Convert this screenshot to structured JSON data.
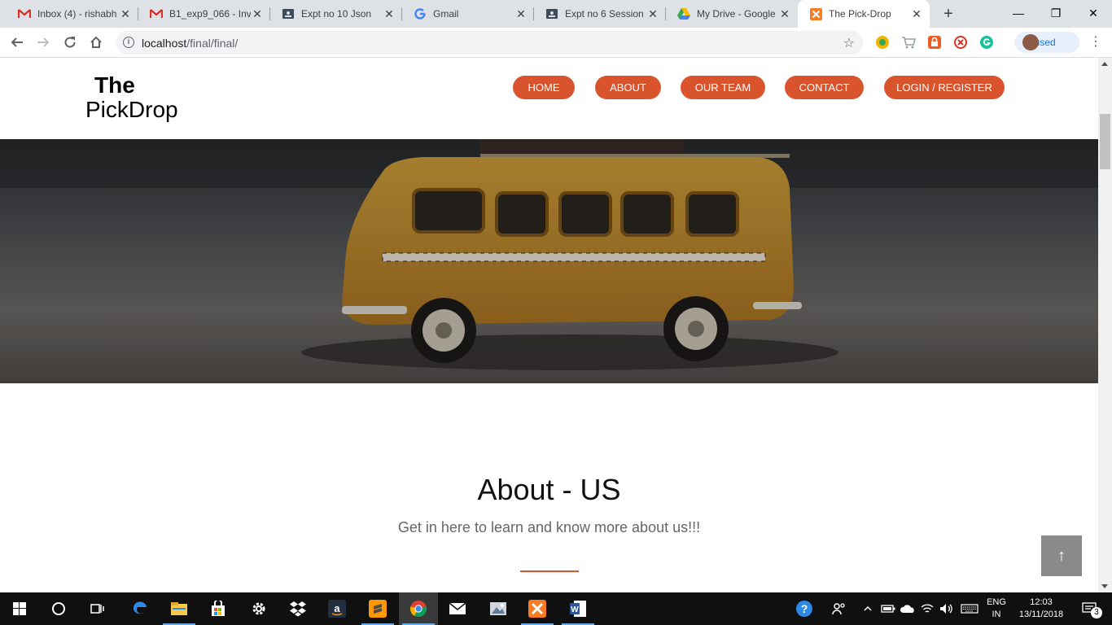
{
  "browser": {
    "tabs": [
      {
        "title": "Inbox (4) - rishabh",
        "icon": "gmail-icon",
        "active": false
      },
      {
        "title": "B1_exp9_066 - Inv",
        "icon": "gmail-icon",
        "active": false
      },
      {
        "title": "Expt no 10 Json",
        "icon": "classroom-icon",
        "active": false
      },
      {
        "title": "Gmail",
        "icon": "google-icon",
        "active": false
      },
      {
        "title": "Expt no 6 Session",
        "icon": "classroom-icon",
        "active": false
      },
      {
        "title": "My Drive - Google",
        "icon": "drive-icon",
        "active": false
      },
      {
        "title": "The Pick-Drop",
        "icon": "xampp-icon",
        "active": true
      }
    ],
    "new_tab": "+",
    "window_controls": {
      "minimize": "—",
      "maximize": "❐",
      "close": "✕"
    },
    "address": {
      "host": "localhost",
      "path": "/final/final/"
    },
    "profile_status": "Paused"
  },
  "site": {
    "logo": {
      "line1": "The",
      "line2": "PickDrop"
    },
    "nav": [
      "HOME",
      "ABOUT",
      "OUR TEAM",
      "CONTACT",
      "LOGIN / REGISTER"
    ],
    "accent": "#d9532c",
    "about": {
      "title": "About - US",
      "subtitle": "Get in here to learn and know more about us!!!"
    },
    "back_to_top": "↑"
  },
  "taskbar": {
    "apps": [
      "start-icon",
      "cortana-icon",
      "task-view-icon",
      "edge-icon",
      "file-explorer-icon",
      "store-icon",
      "settings-icon",
      "dropbox-icon",
      "amazon-icon",
      "sublime-icon",
      "chrome-icon",
      "mail-icon",
      "photos-icon",
      "xampp-icon",
      "word-icon"
    ],
    "language": {
      "line1": "ENG",
      "line2": "IN"
    },
    "time": "12:03",
    "date": "13/11/2018",
    "notifications": "3"
  }
}
